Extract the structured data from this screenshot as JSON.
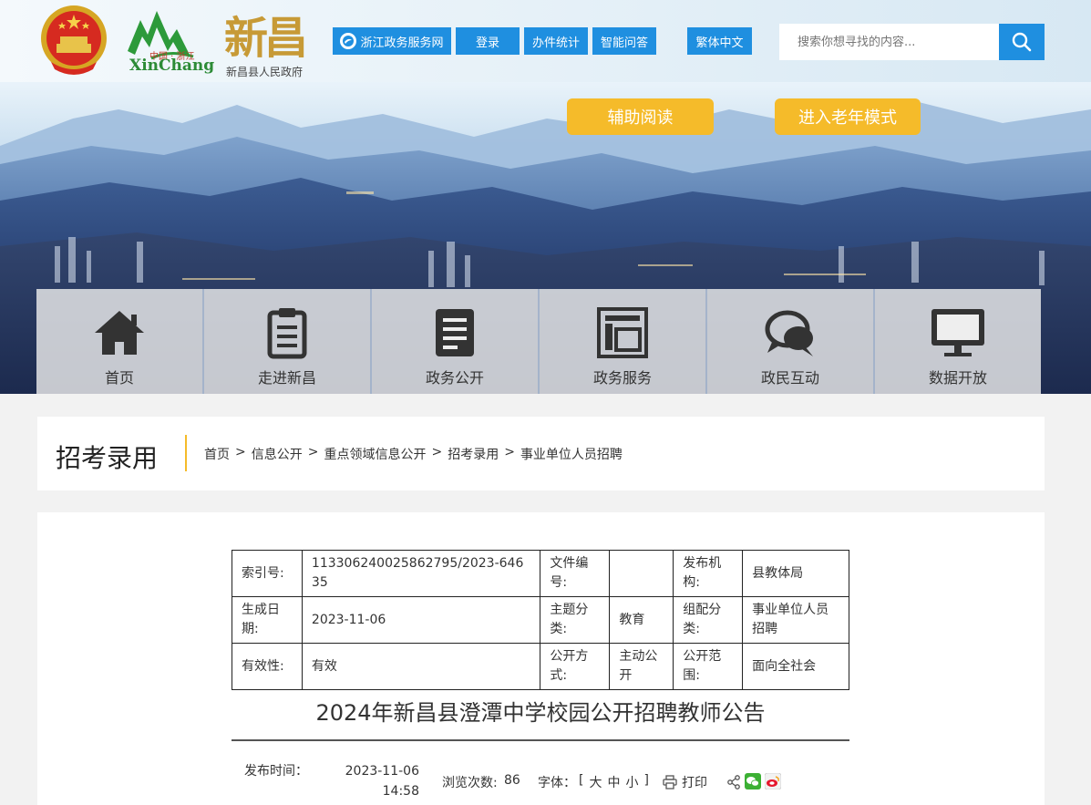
{
  "header": {
    "logo_china": "中国 · 浙江",
    "logo_pinyin": "XinChang",
    "logo_chars": "新昌",
    "logo_sub": "新昌县人民政府",
    "links": [
      {
        "label": "浙江政务服务网"
      },
      {
        "label": "登录"
      },
      {
        "label": "办件统计"
      },
      {
        "label": "智能问答"
      },
      {
        "label": "繁体中文"
      }
    ],
    "search_placeholder": "搜索你想寻找的内容...",
    "assist_reading": "辅助阅读",
    "elder_mode": "进入老年模式"
  },
  "nav": [
    {
      "label": "首页",
      "icon": "home-icon"
    },
    {
      "label": "走进新昌",
      "icon": "clipboard-icon"
    },
    {
      "label": "政务公开",
      "icon": "document-icon"
    },
    {
      "label": "政务服务",
      "icon": "frame-icon"
    },
    {
      "label": "政民互动",
      "icon": "chat-icon"
    },
    {
      "label": "数据开放",
      "icon": "monitor-icon"
    }
  ],
  "crumb": {
    "title": "招考录用",
    "items": [
      "首页",
      "信息公开",
      "重点领域信息公开",
      "招考录用",
      "事业单位人员招聘"
    ],
    "separator": ">"
  },
  "meta": {
    "index_label": "索引号:",
    "index_value": "113306240025862795/2023-64635",
    "docno_label": "文件编号:",
    "docno_value": "",
    "publisher_label": "发布机构:",
    "publisher_value": "县教体局",
    "created_label": "生成日期:",
    "created_value": "2023-11-06",
    "topic_label": "主题分类:",
    "topic_value": "教育",
    "group_label": "组配分类:",
    "group_value": "事业单位人员招聘",
    "valid_label": "有效性:",
    "valid_value": "有效",
    "method_label": "公开方式:",
    "method_value": "主动公开",
    "scope_label": "公开范围:",
    "scope_value": "面向全社会"
  },
  "article": {
    "title": "2024年新昌县澄潭中学校园公开招聘教师公告",
    "pub_label": "发布时间：",
    "pub_time": "2023-11-06 14:58",
    "views_label": "浏览次数:",
    "views": "86",
    "font_label": "字体：",
    "font_open": "[",
    "font_large": "大",
    "font_medium": "中",
    "font_small": "小",
    "font_close": "]",
    "print_label": "打印"
  }
}
